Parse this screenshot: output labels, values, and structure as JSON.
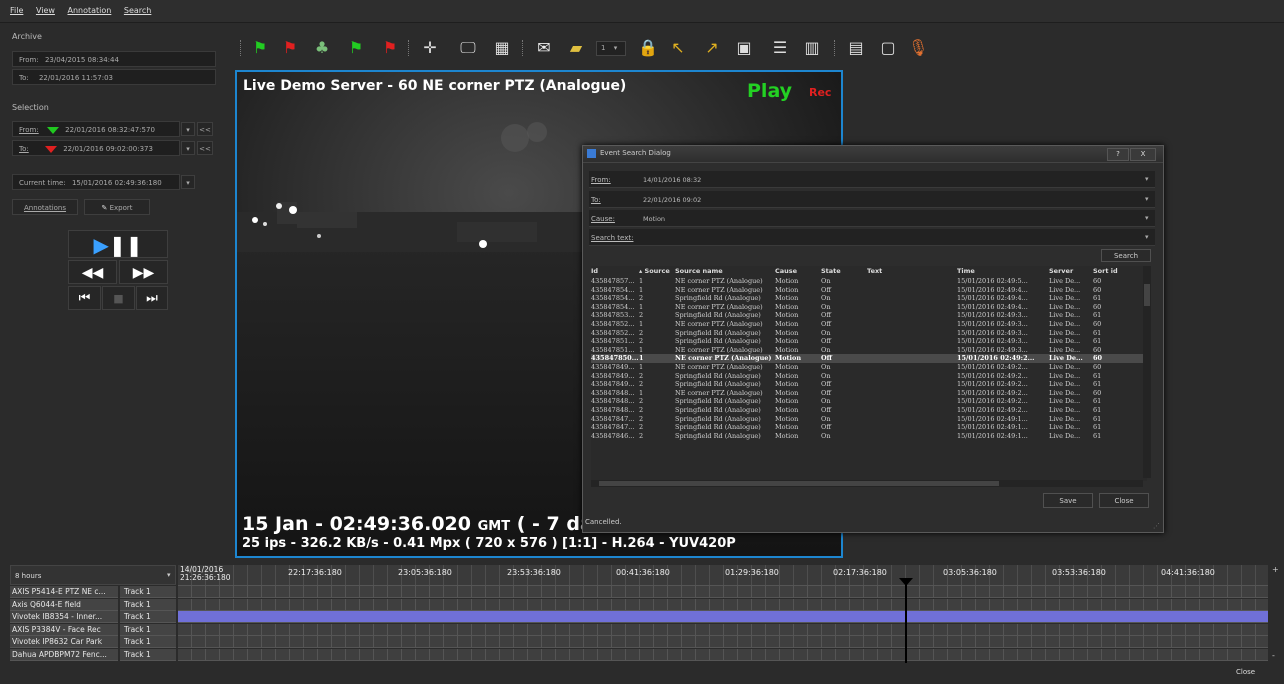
{
  "menu": [
    "File",
    "View",
    "Annotation",
    "Search"
  ],
  "archive": {
    "label": "Archive",
    "from_label": "From:",
    "from_value": "23/04/2015 08:34:44",
    "to_label": "To:",
    "to_value": "22/01/2016 11:57:03"
  },
  "selection": {
    "label": "Selection",
    "from_label": "From:",
    "from_value": "22/01/2016 08:32:47:570",
    "to_label": "To:",
    "to_value": "22/01/2016 09:02:00:373",
    "back_label": "<<"
  },
  "current_time": {
    "label": "Current time:",
    "value": "15/01/2016 02:49:36:180"
  },
  "buttons": {
    "annotations": "Annotations",
    "export": "Export"
  },
  "toolbar": {
    "camera_number": "1",
    "icons": [
      "flag-green-icon",
      "flag-red-icon",
      "tree-icon",
      "flag-green-end-icon",
      "flag-red-end-icon",
      "fullscreen-icon",
      "monitor-icon",
      "grid-icon",
      "snapshot-icon",
      "folder-icon",
      "camera-number-dropdown",
      "lock-icon",
      "undo-icon",
      "redo-icon",
      "overlay-icon",
      "list-icon",
      "columns-icon",
      "display-icon",
      "window-icon",
      "microphone-icon"
    ]
  },
  "video": {
    "title": "Live Demo Server - 60 NE corner PTZ (Analogue)",
    "play": "Play",
    "rec": "Rec",
    "timestamp": "15 Jan - 02:49:36.020",
    "tz": "GMT",
    "offset": "( - 7 da",
    "stats": "25 ips  -  326.2 KB/s  -  0.41 Mpx  ( 720 x 576 ) [1:1] -  H.264  -  YUV420P",
    "status": "Cancelled."
  },
  "dialog": {
    "title": "Event Search Dialog",
    "help": "?",
    "close_x": "X",
    "from_label": "From:",
    "from_value": "14/01/2016 08:32",
    "to_label": "To:",
    "to_value": "22/01/2016 09:02",
    "cause_label": "Cause:",
    "cause_value": "Motion",
    "search_text_label": "Search text:",
    "search_text_value": "",
    "search_button": "Search",
    "save_button": "Save",
    "close_button": "Close",
    "columns": [
      "Id",
      "Source",
      "Source name",
      "Cause",
      "State",
      "Text",
      "Time",
      "Server",
      "Sort id"
    ],
    "selected_row": 11,
    "rows": [
      [
        "435847857...",
        "1",
        "NE corner PTZ (Analogue)",
        "Motion",
        "On",
        "",
        "15/01/2016 02:49:5...",
        "Live De...",
        "60"
      ],
      [
        "435847854...",
        "1",
        "NE corner PTZ (Analogue)",
        "Motion",
        "Off",
        "",
        "15/01/2016 02:49:4...",
        "Live De...",
        "60"
      ],
      [
        "435847854...",
        "2",
        "Springfield Rd (Analogue)",
        "Motion",
        "On",
        "",
        "15/01/2016 02:49:4...",
        "Live De...",
        "61"
      ],
      [
        "435847854...",
        "1",
        "NE corner PTZ (Analogue)",
        "Motion",
        "On",
        "",
        "15/01/2016 02:49:4...",
        "Live De...",
        "60"
      ],
      [
        "435847853...",
        "2",
        "Springfield Rd (Analogue)",
        "Motion",
        "Off",
        "",
        "15/01/2016 02:49:3...",
        "Live De...",
        "61"
      ],
      [
        "435847852...",
        "1",
        "NE corner PTZ (Analogue)",
        "Motion",
        "Off",
        "",
        "15/01/2016 02:49:3...",
        "Live De...",
        "60"
      ],
      [
        "435847852...",
        "2",
        "Springfield Rd (Analogue)",
        "Motion",
        "On",
        "",
        "15/01/2016 02:49:3...",
        "Live De...",
        "61"
      ],
      [
        "435847851...",
        "2",
        "Springfield Rd (Analogue)",
        "Motion",
        "Off",
        "",
        "15/01/2016 02:49:3...",
        "Live De...",
        "61"
      ],
      [
        "435847851...",
        "1",
        "NE corner PTZ (Analogue)",
        "Motion",
        "On",
        "",
        "15/01/2016 02:49:3...",
        "Live De...",
        "60"
      ],
      [
        "435847850...",
        "1",
        "NE corner PTZ (Analogue)",
        "Motion",
        "Off",
        "",
        "15/01/2016 02:49:2...",
        "Live De...",
        "60"
      ],
      [
        "435847849...",
        "1",
        "NE corner PTZ (Analogue)",
        "Motion",
        "On",
        "",
        "15/01/2016 02:49:2...",
        "Live De...",
        "60"
      ],
      [
        "435847849...",
        "2",
        "Springfield Rd (Analogue)",
        "Motion",
        "On",
        "",
        "15/01/2016 02:49:2...",
        "Live De...",
        "61"
      ],
      [
        "435847849...",
        "2",
        "Springfield Rd (Analogue)",
        "Motion",
        "Off",
        "",
        "15/01/2016 02:49:2...",
        "Live De...",
        "61"
      ],
      [
        "435847848...",
        "1",
        "NE corner PTZ (Analogue)",
        "Motion",
        "Off",
        "",
        "15/01/2016 02:49:2...",
        "Live De...",
        "60"
      ],
      [
        "435847848...",
        "2",
        "Springfield Rd (Analogue)",
        "Motion",
        "On",
        "",
        "15/01/2016 02:49:2...",
        "Live De...",
        "61"
      ],
      [
        "435847848...",
        "2",
        "Springfield Rd (Analogue)",
        "Motion",
        "Off",
        "",
        "15/01/2016 02:49:2...",
        "Live De...",
        "61"
      ],
      [
        "435847847...",
        "2",
        "Springfield Rd (Analogue)",
        "Motion",
        "On",
        "",
        "15/01/2016 02:49:1...",
        "Live De...",
        "61"
      ],
      [
        "435847847...",
        "2",
        "Springfield Rd (Analogue)",
        "Motion",
        "Off",
        "",
        "15/01/2016 02:49:1...",
        "Live De...",
        "61"
      ],
      [
        "435847846...",
        "2",
        "Springfield Rd (Analogue)",
        "Motion",
        "On",
        "",
        "15/01/2016 02:49:1...",
        "Live De...",
        "61"
      ]
    ]
  },
  "timeline": {
    "zoom": "8 hours",
    "first_label_date": "14/01/2016",
    "first_label_time": "21:26:36:180",
    "ruler": [
      "22:17:36:180",
      "23:05:36:180",
      "23:53:36:180",
      "00:41:36:180",
      "01:29:36:180",
      "02:17:36:180",
      "03:05:36:180",
      "03:53:36:180",
      "04:41:36:180"
    ],
    "tracks": [
      {
        "name": "AXIS P5414-E PTZ NE c...",
        "track": "Track 1"
      },
      {
        "name": "Axis Q6044-E field",
        "track": "Track 1"
      },
      {
        "name": "Vivotek IB8354 - Inner...",
        "track": "Track 1"
      },
      {
        "name": "AXIS P3384V - Face Rec",
        "track": "Track 1"
      },
      {
        "name": "Vivotek IP8632 Car Park",
        "track": "Track 1"
      },
      {
        "name": "Dahua APDBPM72 Fenc...",
        "track": "Track 1"
      }
    ],
    "highlight_color": "#7070d8",
    "plus": "+",
    "minus": "-"
  },
  "footer": {
    "close": "Close"
  }
}
